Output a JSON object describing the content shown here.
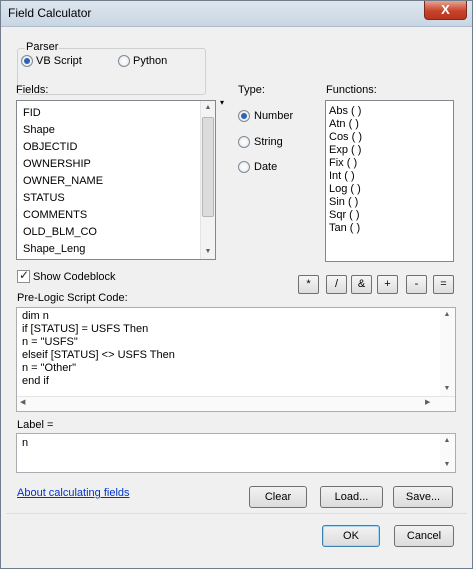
{
  "window": {
    "title": "Field Calculator",
    "close_glyph": "X"
  },
  "parser": {
    "label": "Parser",
    "options": [
      {
        "label": "VB Script",
        "selected": true
      },
      {
        "label": "Python",
        "selected": false
      }
    ]
  },
  "fields": {
    "label": "Fields:",
    "items": [
      "FID",
      "Shape",
      "OBJECTID",
      "OWNERSHIP",
      "OWNER_NAME",
      "STATUS",
      "COMMENTS",
      "OLD_BLM_CO",
      "Shape_Leng"
    ]
  },
  "type": {
    "label": "Type:",
    "options": [
      {
        "label": "Number",
        "selected": true
      },
      {
        "label": "String",
        "selected": false
      },
      {
        "label": "Date",
        "selected": false
      }
    ]
  },
  "functions": {
    "label": "Functions:",
    "items": [
      "Abs ( )",
      "Atn ( )",
      "Cos ( )",
      "Exp ( )",
      "Fix ( )",
      "Int ( )",
      "Log ( )",
      "Sin ( )",
      "Sqr ( )",
      "Tan ( )"
    ]
  },
  "codeblock": {
    "label": "Show Codeblock",
    "checked": true
  },
  "operators": [
    "*",
    "/",
    "&",
    "+",
    "-",
    "="
  ],
  "prelogic": {
    "label": "Pre-Logic Script Code:",
    "lines": [
      "dim n",
      "if [STATUS] = USFS Then",
      "n = \"USFS\"",
      "elseif [STATUS] <> USFS Then",
      "n = \"Other\"",
      "end if"
    ]
  },
  "label_expr": {
    "label": "Label =",
    "value": "n"
  },
  "about_link": "About calculating fields",
  "buttons": {
    "clear": "Clear",
    "load": "Load...",
    "save": "Save...",
    "ok": "OK",
    "cancel": "Cancel"
  }
}
